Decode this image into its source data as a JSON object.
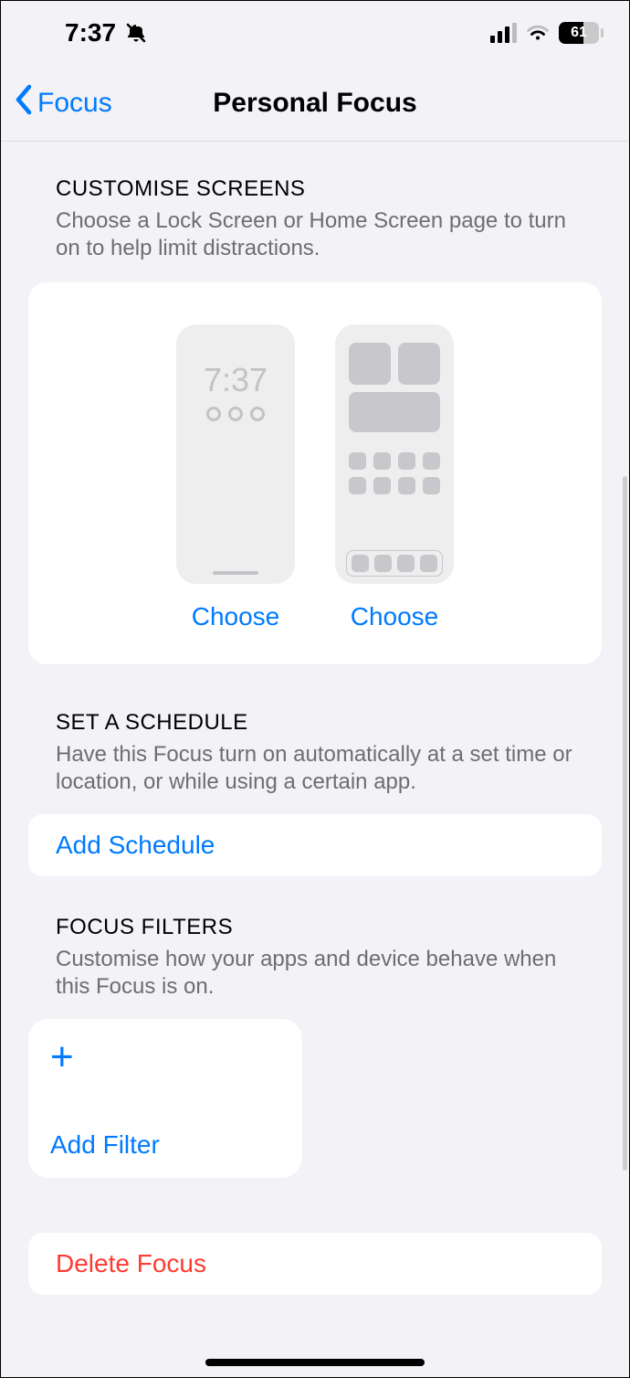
{
  "status": {
    "time": "7:37",
    "battery_pct": "61"
  },
  "nav": {
    "back_label": "Focus",
    "title": "Personal Focus"
  },
  "customise": {
    "header": "Customise Screens",
    "sub": "Choose a Lock Screen or Home Screen page to turn on to help limit distractions.",
    "lock_time": "7:37",
    "choose_lock": "Choose",
    "choose_home": "Choose"
  },
  "schedule": {
    "header": "Set a Schedule",
    "sub": "Have this Focus turn on automatically at a set time or location, or while using a certain app.",
    "add_label": "Add Schedule"
  },
  "filters": {
    "header": "Focus Filters",
    "sub": "Customise how your apps and device behave when this Focus is on.",
    "add_label": "Add Filter"
  },
  "delete_label": "Delete Focus"
}
